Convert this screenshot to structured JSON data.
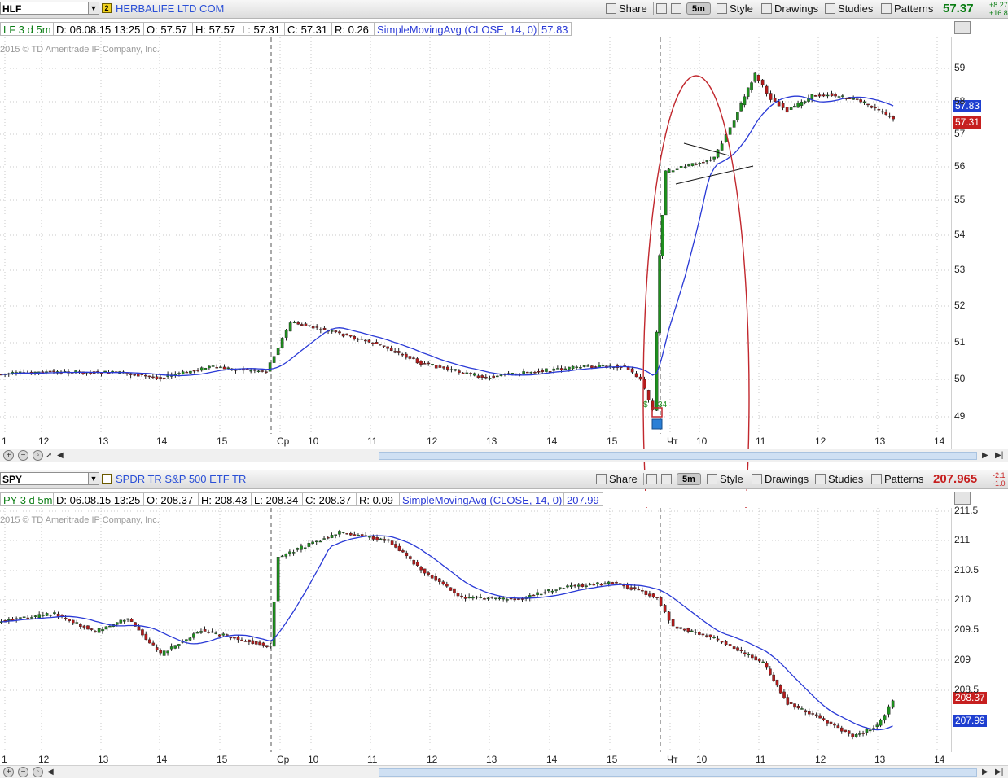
{
  "panels": [
    {
      "id": "hlf",
      "symbol": "HLF",
      "link_number": "2",
      "description": "HERBALIFE LTD COM",
      "toolbar": {
        "share": "Share",
        "interval": "5m",
        "style": "Style",
        "drawings": "Drawings",
        "studies": "Studies",
        "patterns": "Patterns"
      },
      "last_price": "57.37",
      "change_top": "+8.27",
      "change_bottom": "+16.8",
      "info": {
        "chart_spec": "LF 3 d 5m",
        "date": "D: 06.08.15 13:25",
        "open": "O: 57.57",
        "high": "H: 57.57",
        "low": "L: 57.31",
        "close": "C: 57.31",
        "range": "R: 0.26",
        "study": "SimpleMovingAvg (CLOSE, 14, 0)",
        "study_value": "57.83"
      },
      "copyright": "2015 © TD Ameritrade IP Company, Inc.",
      "y_ticks": [
        "59",
        "58",
        "57",
        "56",
        "55",
        "54",
        "53",
        "52",
        "51",
        "50",
        "49"
      ],
      "sma_tag": "57.83",
      "price_tag": "57.31",
      "x_labels": [
        "1",
        "12",
        "13",
        "14",
        "15",
        "Ср",
        "10",
        "11",
        "12",
        "13",
        "14",
        "15",
        "Чт",
        "10",
        "11",
        "12",
        "13",
        "14"
      ],
      "event_label": "$",
      "event_value": "34"
    },
    {
      "id": "spy",
      "symbol": "SPY",
      "link_number": "",
      "description": "SPDR TR S&P 500 ETF TR",
      "toolbar": {
        "share": "Share",
        "interval": "5m",
        "style": "Style",
        "drawings": "Drawings",
        "studies": "Studies",
        "patterns": "Patterns"
      },
      "last_price": "207.965",
      "change_top": "-2.1",
      "change_bottom": "-1.0",
      "info": {
        "chart_spec": "PY 3 d 5m",
        "date": "D: 06.08.15 13:25",
        "open": "O: 208.37",
        "high": "H: 208.43",
        "low": "L: 208.34",
        "close": "C: 208.37",
        "range": "R: 0.09",
        "study": "SimpleMovingAvg (CLOSE, 14, 0)",
        "study_value": "207.99"
      },
      "copyright": "2015 © TD Ameritrade IP Company, Inc.",
      "y_ticks": [
        "211.5",
        "211",
        "210.5",
        "210",
        "209.5",
        "209",
        "208.5"
      ],
      "sma_tag": "207.99",
      "price_tag": "208.37",
      "x_labels": [
        "1",
        "12",
        "13",
        "14",
        "15",
        "Ср",
        "10",
        "11",
        "12",
        "13",
        "14",
        "15",
        "Чт",
        "10",
        "11",
        "12",
        "13",
        "14"
      ]
    }
  ],
  "colors": {
    "up_candle": "#1e8f1e",
    "down_candle": "#b31b1b",
    "sma_line": "#2a3ad6",
    "annotation": "#c1272d",
    "sma_tag_bg": "#1f3fd0",
    "price_tag_bg": "#c61f1f",
    "hlf_price": "#0b7d14",
    "spy_price": "#c61f1f"
  },
  "icons": [
    "share-icon",
    "tools-icon",
    "settings-icon",
    "style-icon",
    "drawings-icon",
    "studies-icon",
    "patterns-icon",
    "zoom-in-icon",
    "zoom-out-icon",
    "cursor-icon"
  ]
}
